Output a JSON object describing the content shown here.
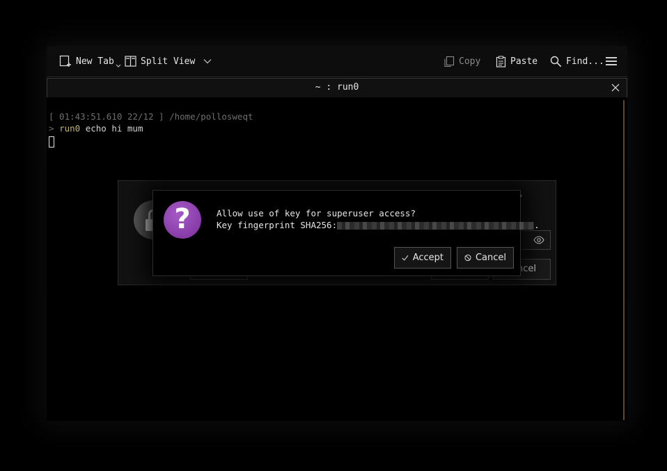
{
  "toolbar": {
    "new_tab_label": "New Tab",
    "split_view_label": "Split View",
    "copy_label": "Copy",
    "paste_label": "Paste",
    "find_label": "Find..."
  },
  "tab": {
    "title": "~ : run0"
  },
  "terminal": {
    "prompt_info": "[ 01:43:51.610 22/12 ] /home/pollosweqt",
    "prompt_symbol": ">",
    "command_name": "run0",
    "command_args": " echo hi mum"
  },
  "auth_dialog": {
    "cancel_label": "ancel"
  },
  "key_dialog": {
    "question_mark": "?",
    "line1": "Allow use of key for superuser access?",
    "line2_prefix": "Key fingerprint SHA256:",
    "line2_suffix": ".",
    "accept_label": "Accept",
    "cancel_label": "Cancel"
  },
  "colors": {
    "accent_purple": "#8a3aa8",
    "command_yellow": "#c8b46a",
    "scrollbar": "#5a4a2e"
  }
}
